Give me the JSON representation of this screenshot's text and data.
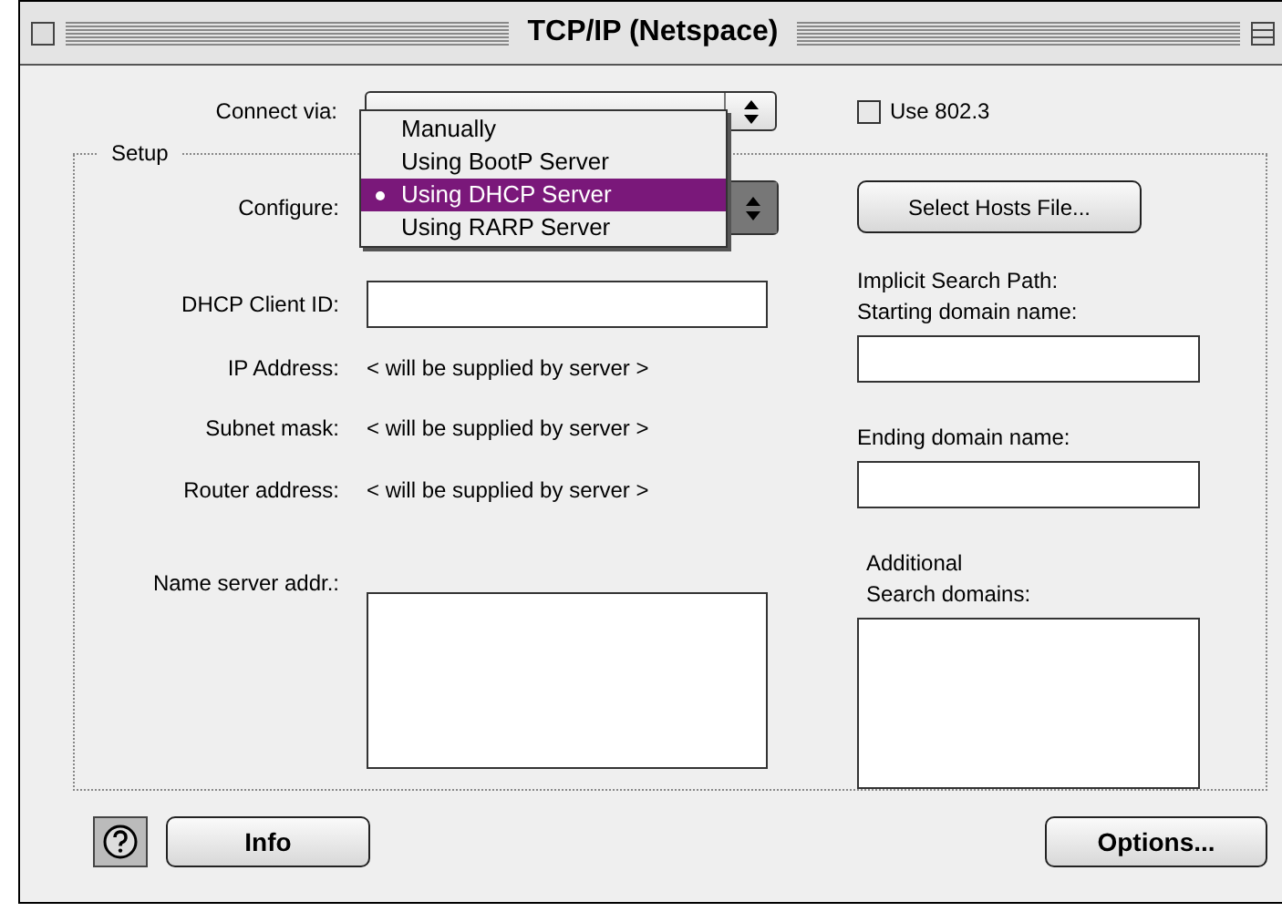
{
  "window": {
    "title": "TCP/IP (Netspace)"
  },
  "connect_via": {
    "label": "Connect via:"
  },
  "use_802_3": {
    "label": "Use 802.3",
    "checked": false
  },
  "setup": {
    "title": "Setup",
    "configure": {
      "label": "Configure:",
      "menu": [
        {
          "label": "Manually",
          "selected": false
        },
        {
          "label": "Using BootP Server",
          "selected": false
        },
        {
          "label": "Using DHCP Server",
          "selected": true
        },
        {
          "label": "Using RARP Server",
          "selected": false
        }
      ]
    },
    "select_hosts_button": "Select Hosts File...",
    "fields": [
      {
        "label": "DHCP Client ID:",
        "kind": "input"
      },
      {
        "label": "IP Address:",
        "kind": "text",
        "value": "< will be supplied by server >"
      },
      {
        "label": "Subnet mask:",
        "kind": "text",
        "value": "< will be supplied by server >"
      },
      {
        "label": "Router address:",
        "kind": "text",
        "value": "< will be supplied by server >"
      },
      {
        "label": "Name server addr.:",
        "kind": "textarea"
      }
    ],
    "search_path": {
      "title": "Implicit Search Path:",
      "starting_label": "Starting domain name:",
      "ending_label": "Ending domain name:",
      "additional_label_1": "Additional",
      "additional_label_2": "Search domains:"
    }
  },
  "buttons": {
    "info": "Info",
    "options": "Options..."
  }
}
